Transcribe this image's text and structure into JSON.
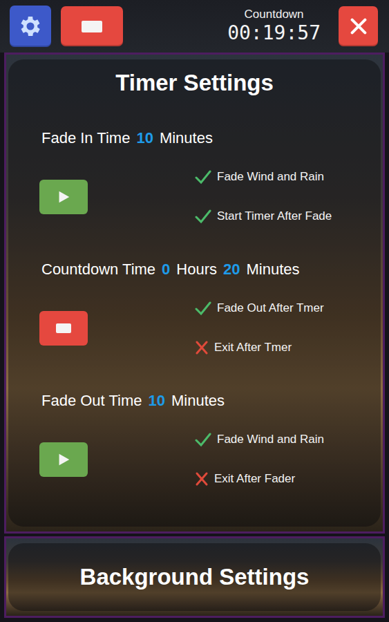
{
  "toolbar": {
    "countdown_label": "Countdown",
    "countdown_value": "00:19:57"
  },
  "timer_settings": {
    "title": "Timer Settings",
    "sections": [
      {
        "label": "Fade In Time",
        "values": [
          {
            "value": "10",
            "unit": "Minutes"
          }
        ],
        "button": {
          "kind": "play"
        },
        "options": [
          {
            "label": "Fade Wind and Rain",
            "checked": true
          },
          {
            "label": "Start Timer After Fade",
            "checked": true
          }
        ]
      },
      {
        "label": "Countdown Time",
        "values": [
          {
            "value": "0",
            "unit": "Hours"
          },
          {
            "value": "20",
            "unit": "Minutes"
          }
        ],
        "button": {
          "kind": "stop"
        },
        "options": [
          {
            "label": "Fade Out After Tmer",
            "checked": true
          },
          {
            "label": "Exit After Tmer",
            "checked": false
          }
        ]
      },
      {
        "label": "Fade Out Time",
        "values": [
          {
            "value": "10",
            "unit": "Minutes"
          }
        ],
        "button": {
          "kind": "play"
        },
        "options": [
          {
            "label": "Fade Wind and Rain",
            "checked": true
          },
          {
            "label": "Exit After Fader",
            "checked": false
          }
        ]
      }
    ]
  },
  "background_settings": {
    "title": "Background Settings"
  }
}
